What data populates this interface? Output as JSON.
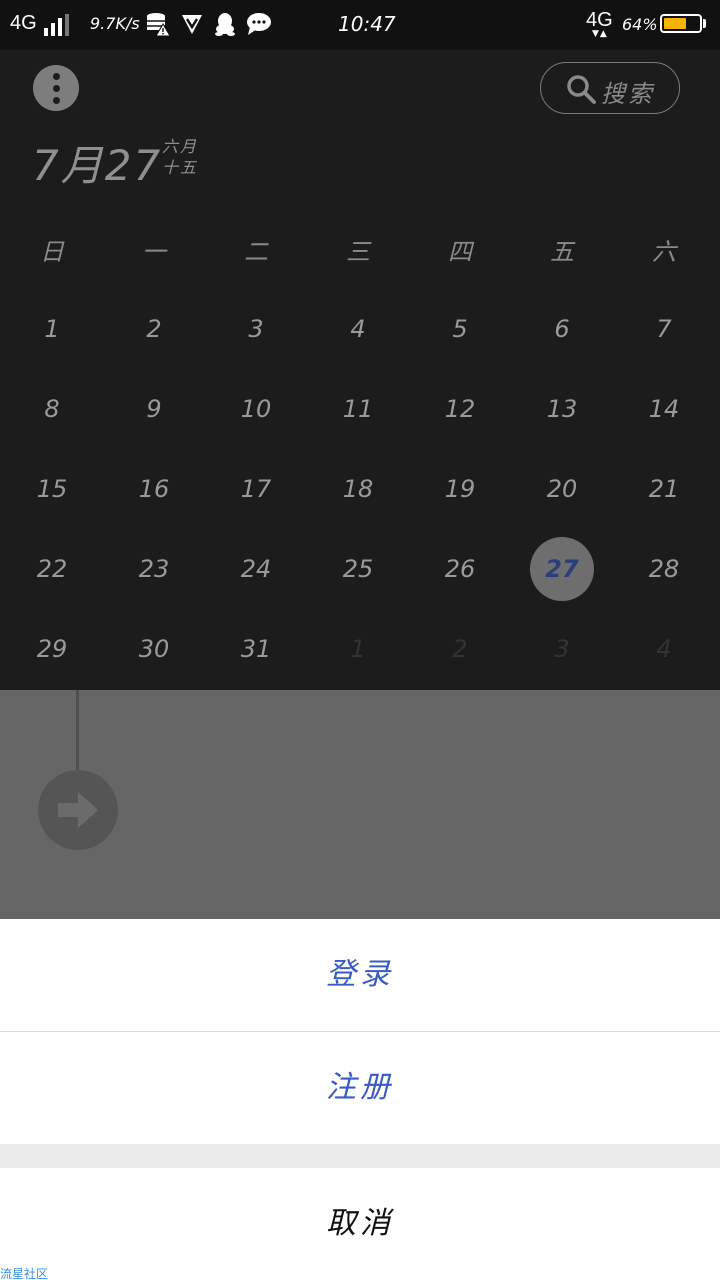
{
  "status_bar": {
    "network_left": "4G",
    "speed": "9.7K/s",
    "time": "10:47",
    "network_right": "4G",
    "arrows": "▼▲",
    "battery_percent": "64%",
    "battery_level": 0.64,
    "icons": [
      "signal-icon",
      "storage-warning-icon",
      "shield-v-icon",
      "qq-icon",
      "chat-bubble-icon",
      "battery-icon"
    ],
    "battery_color": "#f5b400"
  },
  "header": {
    "menu_icon": "more-vertical-icon",
    "search_label": "搜索",
    "search_icon": "search-icon"
  },
  "date_display": {
    "date": "7月27",
    "lunar_month": "六月",
    "lunar_day": "十五"
  },
  "weekdays": [
    "日",
    "一",
    "二",
    "三",
    "四",
    "五",
    "六"
  ],
  "calendar": {
    "selected_day": "27",
    "selected_color": "#2a3e7a",
    "weeks": [
      [
        {
          "d": "1"
        },
        {
          "d": "2"
        },
        {
          "d": "3"
        },
        {
          "d": "4"
        },
        {
          "d": "5"
        },
        {
          "d": "6"
        },
        {
          "d": "7"
        }
      ],
      [
        {
          "d": "8"
        },
        {
          "d": "9"
        },
        {
          "d": "10"
        },
        {
          "d": "11"
        },
        {
          "d": "12"
        },
        {
          "d": "13"
        },
        {
          "d": "14"
        }
      ],
      [
        {
          "d": "15"
        },
        {
          "d": "16"
        },
        {
          "d": "17"
        },
        {
          "d": "18"
        },
        {
          "d": "19"
        },
        {
          "d": "20"
        },
        {
          "d": "21"
        }
      ],
      [
        {
          "d": "22"
        },
        {
          "d": "23"
        },
        {
          "d": "24"
        },
        {
          "d": "25"
        },
        {
          "d": "26"
        },
        {
          "d": "27",
          "selected": true
        },
        {
          "d": "28"
        }
      ],
      [
        {
          "d": "29"
        },
        {
          "d": "30"
        },
        {
          "d": "31"
        },
        {
          "d": "1",
          "other": true
        },
        {
          "d": "2",
          "other": true
        },
        {
          "d": "3",
          "other": true
        },
        {
          "d": "4",
          "other": true
        }
      ]
    ]
  },
  "content": {
    "arrow_icon": "arrow-right-icon"
  },
  "action_sheet": {
    "login": "登录",
    "register": "注册",
    "cancel": "取消",
    "accent_color": "#3b5bc4"
  },
  "watermark": "流星社区"
}
